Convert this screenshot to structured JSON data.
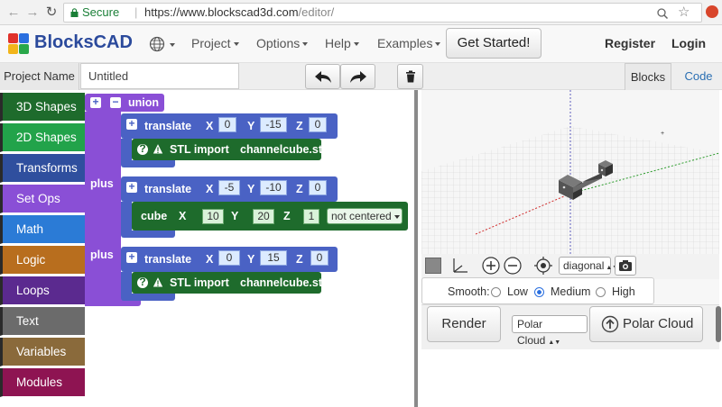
{
  "browser": {
    "secure_label": "Secure",
    "url_host": "https://www.blockscad3d.com",
    "url_path": "/editor/"
  },
  "nav": {
    "brand": "BlocksCAD",
    "project": "Project",
    "options": "Options",
    "help": "Help",
    "examples": "Examples",
    "get_started": "Get Started!",
    "register": "Register",
    "login": "Login"
  },
  "project_bar": {
    "label": "Project Name",
    "value": "Untitled",
    "tab_blocks": "Blocks",
    "tab_code": "Code"
  },
  "toolbox": [
    {
      "label": "3D Shapes",
      "color": "#1e6b2c"
    },
    {
      "label": "2D Shapes",
      "color": "#22a34a"
    },
    {
      "label": "Transforms",
      "color": "#2f4f9e"
    },
    {
      "label": "Set Ops",
      "color": "#8a4fd6"
    },
    {
      "label": "Math",
      "color": "#2b7bd6"
    },
    {
      "label": "Logic",
      "color": "#b86e1e"
    },
    {
      "label": "Loops",
      "color": "#5b2a8f"
    },
    {
      "label": "Text",
      "color": "#6b6b6b"
    },
    {
      "label": "Variables",
      "color": "#8a6a3b"
    },
    {
      "label": "Modules",
      "color": "#8e1452"
    }
  ],
  "blocks": {
    "union": "union",
    "plus": "plus",
    "translate": "translate",
    "x": "X",
    "y": "Y",
    "z": "Z",
    "t1": {
      "x": "0",
      "y": "-15",
      "z": "0"
    },
    "t2": {
      "x": "-5",
      "y": "-10",
      "z": "0"
    },
    "t3": {
      "x": "0",
      "y": "15",
      "z": "0"
    },
    "stl_import": "STL import",
    "stl_file": "channelcube.stl",
    "cube": "cube",
    "cube_vals": {
      "x": "10",
      "y": "20",
      "z": "1"
    },
    "cube_center": "not centered",
    "help_mark": "?",
    "warn_mark": "!"
  },
  "viewer": {
    "view_select": "diagonal",
    "smooth_label": "Smooth:",
    "smooth_options": [
      "Low",
      "Medium",
      "High"
    ],
    "smooth_selected": "Medium",
    "render": "Render",
    "polar_select": "Polar Cloud",
    "polar_button": "Polar Cloud"
  }
}
